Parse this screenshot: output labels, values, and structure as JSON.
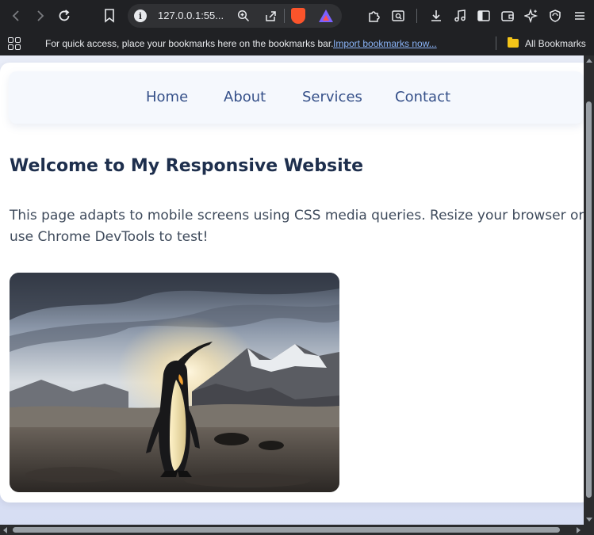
{
  "browser": {
    "url": "127.0.0.1:55...",
    "bookmarks_bar": {
      "prompt_text": "For quick access, place your bookmarks here on the bookmarks bar.",
      "import_link": "Import bookmarks now...",
      "all_bookmarks": "All Bookmarks"
    }
  },
  "page": {
    "nav": [
      "Home",
      "About",
      "Services",
      "Contact"
    ],
    "title": "Welcome to My Responsive Website",
    "body_text": "This page adapts to mobile screens using CSS media queries. Resize your browser or use Chrome DevTools to test!",
    "image_subject": "king penguin on rocky beach with snowy mountains at sunrise"
  },
  "colors": {
    "nav_link": "#355089",
    "title": "#1e2f4d",
    "body_text": "#3f4b5c",
    "chrome_bg": "#202124"
  }
}
